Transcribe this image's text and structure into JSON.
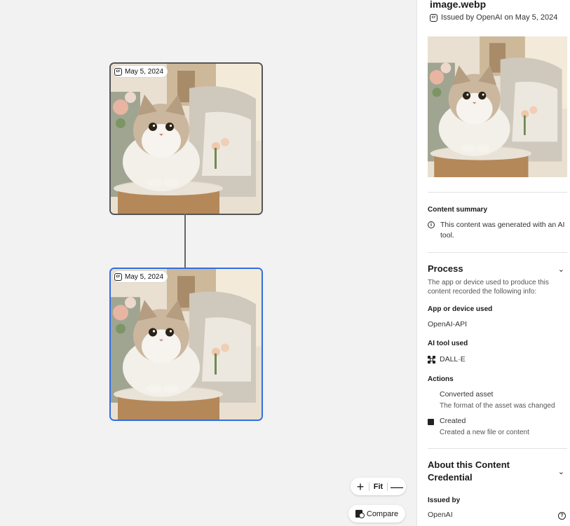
{
  "canvas": {
    "nodes": [
      {
        "date": "May 5, 2024",
        "selected": false
      },
      {
        "date": "May 5, 2024",
        "selected": true
      }
    ],
    "zoom": {
      "plus": "+",
      "fit": "Fit",
      "minus": "—"
    },
    "compare_label": "Compare"
  },
  "panel": {
    "title": "image.webp",
    "issued_line": "Issued by OpenAI on May 5, 2024",
    "content_summary": {
      "heading": "Content summary",
      "text": "This content was generated with an AI tool."
    },
    "process": {
      "heading": "Process",
      "description": "The app or device used to produce this content recorded the following info:",
      "app_label": "App or device used",
      "app_value": "OpenAI-API",
      "ai_tool_label": "AI tool used",
      "ai_tool_value": "DALL·E",
      "actions_label": "Actions",
      "actions": [
        {
          "title": "Converted asset",
          "desc": "The format of the asset was changed"
        },
        {
          "title": "Created",
          "desc": "Created a new file or content"
        }
      ]
    },
    "about": {
      "heading": "About this Content Credential",
      "issued_by_label": "Issued by",
      "issuer": "OpenAI"
    }
  },
  "colors": {
    "selected_border": "#2f6fe0",
    "node_border": "#555555"
  },
  "icons": [
    "content-credential-icon",
    "info-icon",
    "chevron-down-icon",
    "dalle-icon",
    "created-icon",
    "help-icon",
    "compare-icon"
  ]
}
